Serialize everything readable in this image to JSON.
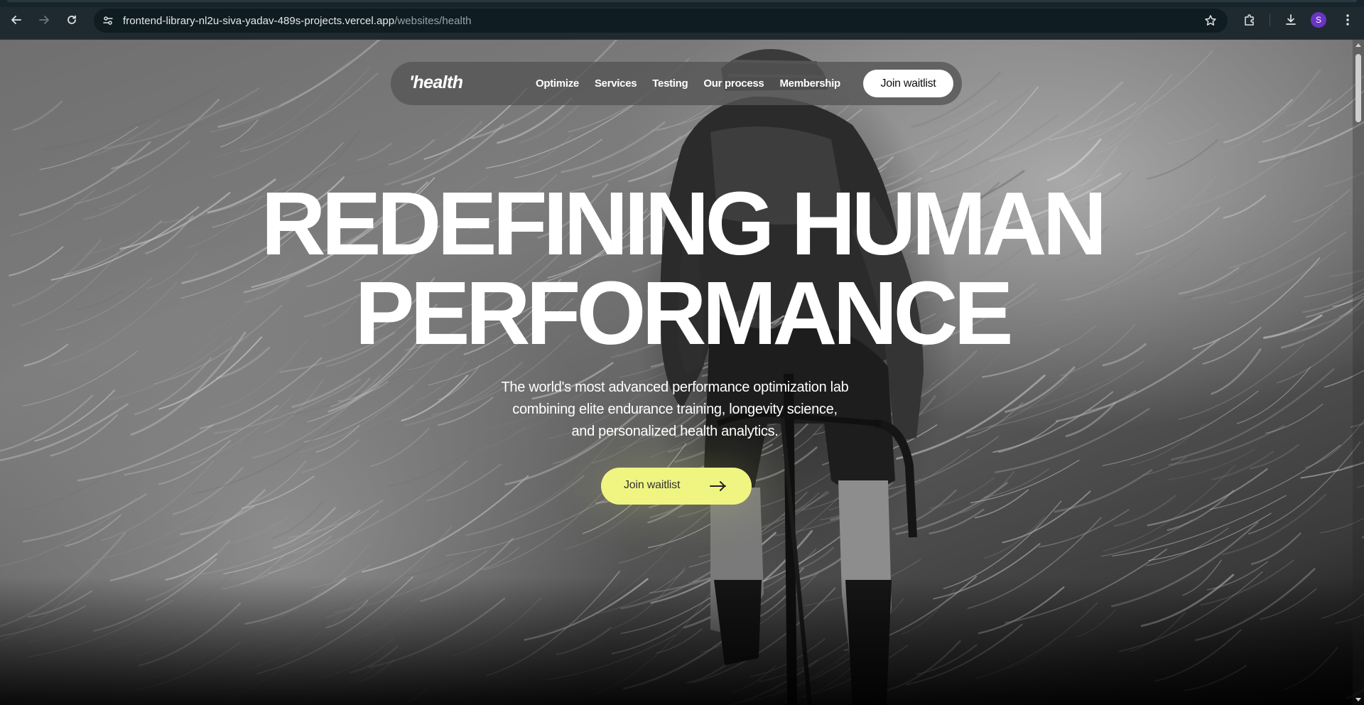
{
  "browser": {
    "url_host": "frontend-library-nl2u-siva-yadav-489s-projects.vercel.app",
    "url_path": "/websites/health",
    "profile_initial": "S",
    "icons": {
      "back": "back-arrow-icon",
      "forward": "forward-arrow-icon",
      "reload": "reload-icon",
      "site_info": "site-settings-icon",
      "bookmark": "star-icon",
      "extensions": "puzzle-icon",
      "downloads": "download-icon",
      "menu": "kebab-menu-icon"
    }
  },
  "site": {
    "logo": "'health",
    "nav": [
      "Optimize",
      "Services",
      "Testing",
      "Our process",
      "Membership"
    ],
    "nav_cta": "Join waitlist"
  },
  "hero": {
    "title_line1": "REDEFINING HUMAN",
    "title_line2": "PERFORMANCE",
    "subtitle_line1": "The world's most advanced performance optimization lab",
    "subtitle_line2": "combining elite endurance training, longevity science,",
    "subtitle_line3": "and personalized health analytics.",
    "cta_label": "Join waitlist",
    "cta_icon": "arrow-right-icon"
  },
  "colors": {
    "cta_accent": "#f0f582",
    "chrome_bg": "#1f2a30",
    "avatar": "#6a35c5"
  }
}
